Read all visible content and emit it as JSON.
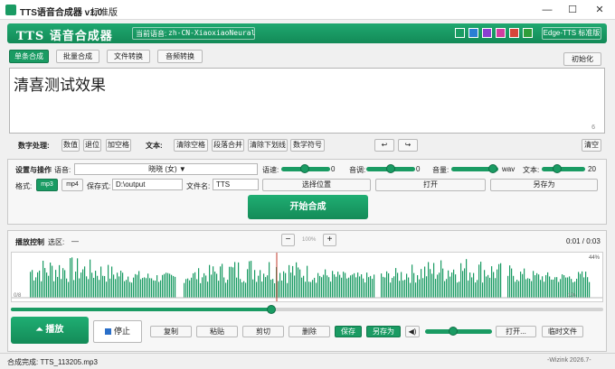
{
  "window": {
    "title": "TTS语音合成器 v1.0",
    "edition": "标准版",
    "controls": [
      "—",
      "☐",
      "✕"
    ]
  },
  "header": {
    "title": "TTS 语音合成器",
    "voice_label": "当前语音:",
    "voice_value": "zh-CN-XiaoxiaoNeural",
    "theme_colors": [
      "#1a9b63",
      "#2a7fd4",
      "#8a3fd1",
      "#d13fa0",
      "#d6463a",
      "#2f9e3a"
    ],
    "edition_badge": "Edge-TTS 标准版"
  },
  "tabs": [
    {
      "label": "单条合成",
      "active": true
    },
    {
      "label": "批量合成",
      "active": false
    },
    {
      "label": "文件转换",
      "active": false
    },
    {
      "label": "音频转换",
      "active": false
    }
  ],
  "init_button": "初始化",
  "editor": {
    "text": "清喜测试效果",
    "char_count": "6"
  },
  "toolbar": {
    "number_label": "数字处理:",
    "number_buttons": [
      "数值",
      "退位",
      "加空格"
    ],
    "text_label": "文本:",
    "text_buttons": [
      "清除空格",
      "段落合并",
      "清除下划线",
      "数学符号"
    ],
    "undo": "↩",
    "redo": "↪",
    "clear": "清空"
  },
  "settings": {
    "section_label": "设置与操作",
    "voice_label": "语音:",
    "voice_value": "晓晓 (女) ▼",
    "speed_label": "语速:",
    "speed_value": "0",
    "pitch_label": "音调:",
    "pitch_value": "0",
    "volume_label": "音量:",
    "volume_value": "wav",
    "textsize_label": "文本:",
    "textsize_value": "20",
    "format_label": "格式:",
    "formats": [
      "mp3",
      "mp4"
    ],
    "save_label": "保存式:",
    "save_path": "D:\\output",
    "filename_label": "文件名:",
    "filename_value": "TTS",
    "choose_location": "选择位置",
    "open": "打开",
    "save_as": "另存为",
    "start": "开始合成"
  },
  "playback": {
    "section_label": "播放控制",
    "selection_label": "选区:",
    "selection_value": "—",
    "zoom_minus": "−",
    "zoom_value": "100%",
    "zoom_plus": "+",
    "time": "0:01 / 0:03",
    "wave_top": "44%",
    "wave_left": "0/8",
    "wave_right": "1%",
    "progress": 0.44,
    "play": "播放",
    "stop": "停止",
    "edit_buttons": [
      "复制",
      "粘贴",
      "剪切",
      "删除"
    ],
    "save": "保存",
    "save_as": "另存为",
    "open_file": "打开...",
    "temp_file": "临时文件"
  },
  "status": {
    "text": "合成完成: TTS_113205.mp3",
    "right": "-Wizink 2026.7-"
  }
}
